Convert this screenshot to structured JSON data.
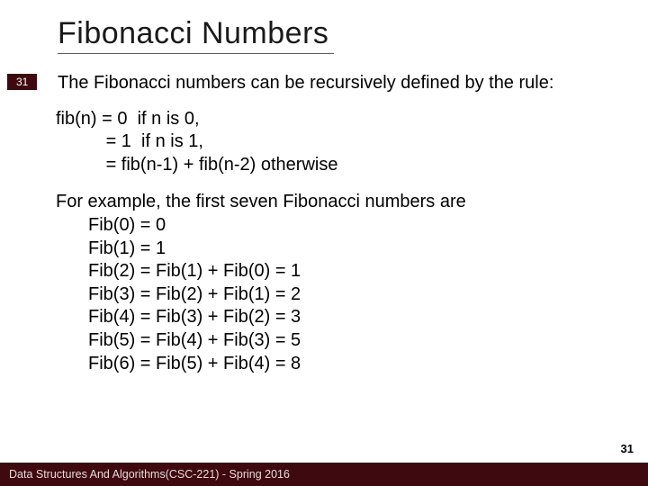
{
  "slide": {
    "title": "Fibonacci Numbers",
    "badge": "31",
    "intro": "The Fibonacci numbers can be recursively defined by the rule:",
    "definition": {
      "line1": "fib(n) = 0  if n is 0,",
      "line2": "          = 1  if n is 1,",
      "line3": "          = fib(n-1) + fib(n-2) otherwise"
    },
    "example_lead": "For example, the first seven Fibonacci numbers are",
    "examples": [
      "Fib(0) = 0",
      "Fib(1) = 1",
      "Fib(2) = Fib(1) + Fib(0) = 1",
      "Fib(3) = Fib(2) + Fib(1) = 2",
      "Fib(4) = Fib(3) + Fib(2) = 3",
      "Fib(5) = Fib(4) + Fib(3) = 5",
      "Fib(6) = Fib(5) + Fib(4) = 8"
    ],
    "page_number": "31",
    "footer": "Data Structures And Algorithms(CSC-221) - Spring 2016"
  }
}
